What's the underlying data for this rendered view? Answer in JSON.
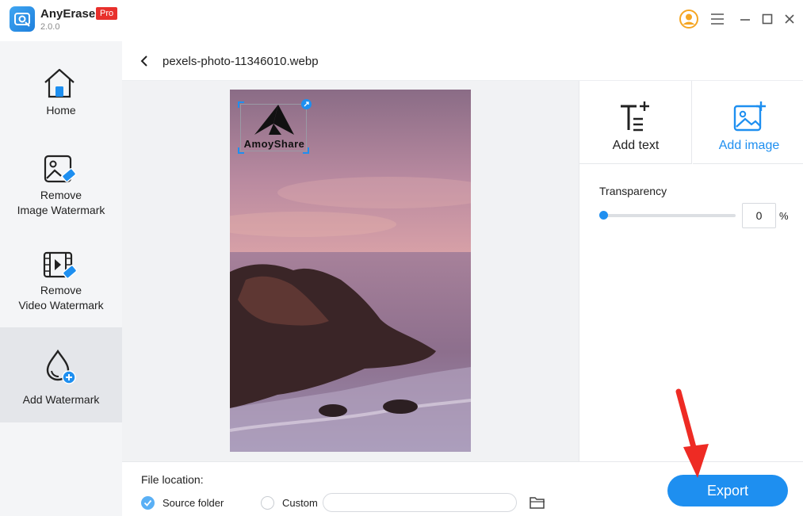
{
  "app": {
    "name": "AnyErase",
    "version": "2.0.0",
    "badge": "Pro"
  },
  "sidebar": {
    "items": [
      {
        "label_lines": [
          "Home"
        ],
        "icon": "home-icon",
        "active": false
      },
      {
        "label_lines": [
          "Remove",
          "Image Watermark"
        ],
        "icon": "image-eraser-icon",
        "active": false
      },
      {
        "label_lines": [
          "Remove",
          "Video Watermark"
        ],
        "icon": "video-eraser-icon",
        "active": false
      },
      {
        "label_lines": [
          "Add Watermark"
        ],
        "icon": "drop-add-icon",
        "active": true
      }
    ]
  },
  "header": {
    "file_name": "pexels-photo-11346010.webp"
  },
  "canvas": {
    "watermark_text": "AmoyShare"
  },
  "tools": {
    "add_text": "Add text",
    "add_image": "Add image",
    "transparency_label": "Transparency",
    "transparency_value": "0",
    "transparency_unit": "%",
    "transparency_level": 0
  },
  "bottom": {
    "file_location_label": "File location:",
    "source_folder": "Source folder",
    "custom": "Custom",
    "custom_path": "",
    "export": "Export"
  },
  "colors": {
    "accent": "#1e8ff0",
    "pro_badge": "#e8302c",
    "sidebar_bg": "#f4f5f7",
    "sidebar_active": "#e4e6ea"
  }
}
